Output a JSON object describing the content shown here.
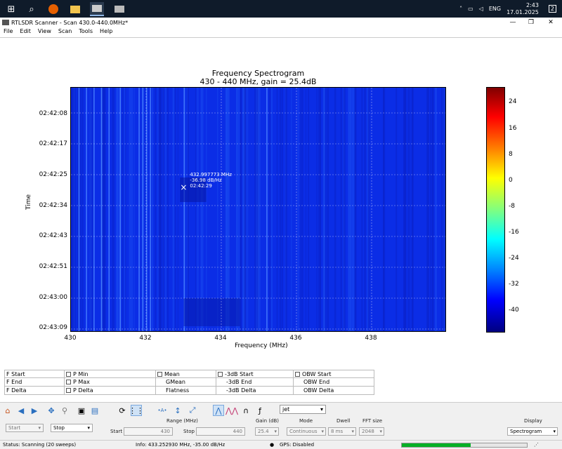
{
  "taskbar": {
    "icons": [
      "windows-icon",
      "search-icon",
      "firefox-icon",
      "file-explorer-icon",
      "rtlsdr-scanner-icon",
      "printer-app-icon"
    ],
    "tray": {
      "lang": "ENG",
      "time": "2:43",
      "date": "17.01.2025",
      "notifications": "2"
    }
  },
  "window": {
    "title": "RTLSDR Scanner - Scan 430.0-440.0MHz*",
    "menu": [
      "File",
      "Edit",
      "View",
      "Scan",
      "Tools",
      "Help"
    ]
  },
  "plot": {
    "title": "Frequency Spectrogram",
    "subtitle": "430 - 440 MHz, gain = 25.4dB",
    "xlabel": "Frequency (MHz)",
    "ylabel": "Time",
    "xticks": [
      "430",
      "432",
      "434",
      "436",
      "438"
    ],
    "yticks": [
      "02:42:08",
      "02:42:17",
      "02:42:25",
      "02:42:34",
      "02:42:43",
      "02:42:51",
      "02:43:00",
      "02:43:09"
    ],
    "cbar_ticks": [
      "24",
      "16",
      "8",
      "0",
      "-8",
      "-16",
      "-24",
      "-32",
      "-40"
    ],
    "annotation": {
      "line1": "432.997773 MHz",
      "line2": "-36.98 dB/Hz",
      "line3": "02:42:29"
    }
  },
  "chart_data": {
    "type": "heatmap",
    "title": "Frequency Spectrogram",
    "subtitle": "430 - 440 MHz, gain = 25.4dB",
    "xlabel": "Frequency (MHz)",
    "ylabel": "Time",
    "xlim": [
      430,
      440
    ],
    "ylim": [
      "02:42:04",
      "02:43:09"
    ],
    "colormap": "jet",
    "clim": [
      -44,
      28
    ],
    "peak_marker": {
      "freq_mhz": 432.997773,
      "level_db_hz": -36.98,
      "time": "02:42:29"
    },
    "strong_lines_mhz": [
      430.2,
      430.4,
      430.6,
      430.8,
      431.0,
      431.3,
      431.8,
      431.9,
      432.0,
      432.1,
      433.0,
      435.2
    ],
    "background_level_db": -34
  },
  "measurements": {
    "col1": [
      "F Start",
      "F End",
      "F Delta"
    ],
    "col2": [
      "P Min",
      "P Max",
      "P Delta"
    ],
    "col3": [
      "Mean",
      "GMean",
      "Flatness"
    ],
    "col4": [
      "-3dB Start",
      "-3dB End",
      "-3dB Delta"
    ],
    "col5": [
      "OBW Start",
      "OBW End",
      "OBW Delta"
    ]
  },
  "toolbar": {
    "colormap": "jet"
  },
  "controls": {
    "start_mode": "Start",
    "stop_mode": "Stop",
    "range_label": "Range (MHz)",
    "start_label": "Start",
    "start_value": "430",
    "stop_label": "Stop",
    "stop_value": "440",
    "gain_label": "Gain (dB)",
    "gain_value": "25.4",
    "mode_label": "Mode",
    "mode_value": "Continuous",
    "dwell_label": "Dwell",
    "dwell_value": "8 ms",
    "fft_label": "FFT size",
    "fft_value": "2048",
    "display_label": "Display",
    "display_value": "Spectrogram"
  },
  "status": {
    "status": "Status: Scanning (20 sweeps)",
    "info": "Info: 433.252930 MHz, -35.00 dB/Hz",
    "gps": "GPS: Disabled",
    "progress": 0.55
  },
  "colors": {
    "taskbar": "#0f1b2a",
    "plot_bg": "#0b2de6",
    "progress": "#06b025"
  }
}
